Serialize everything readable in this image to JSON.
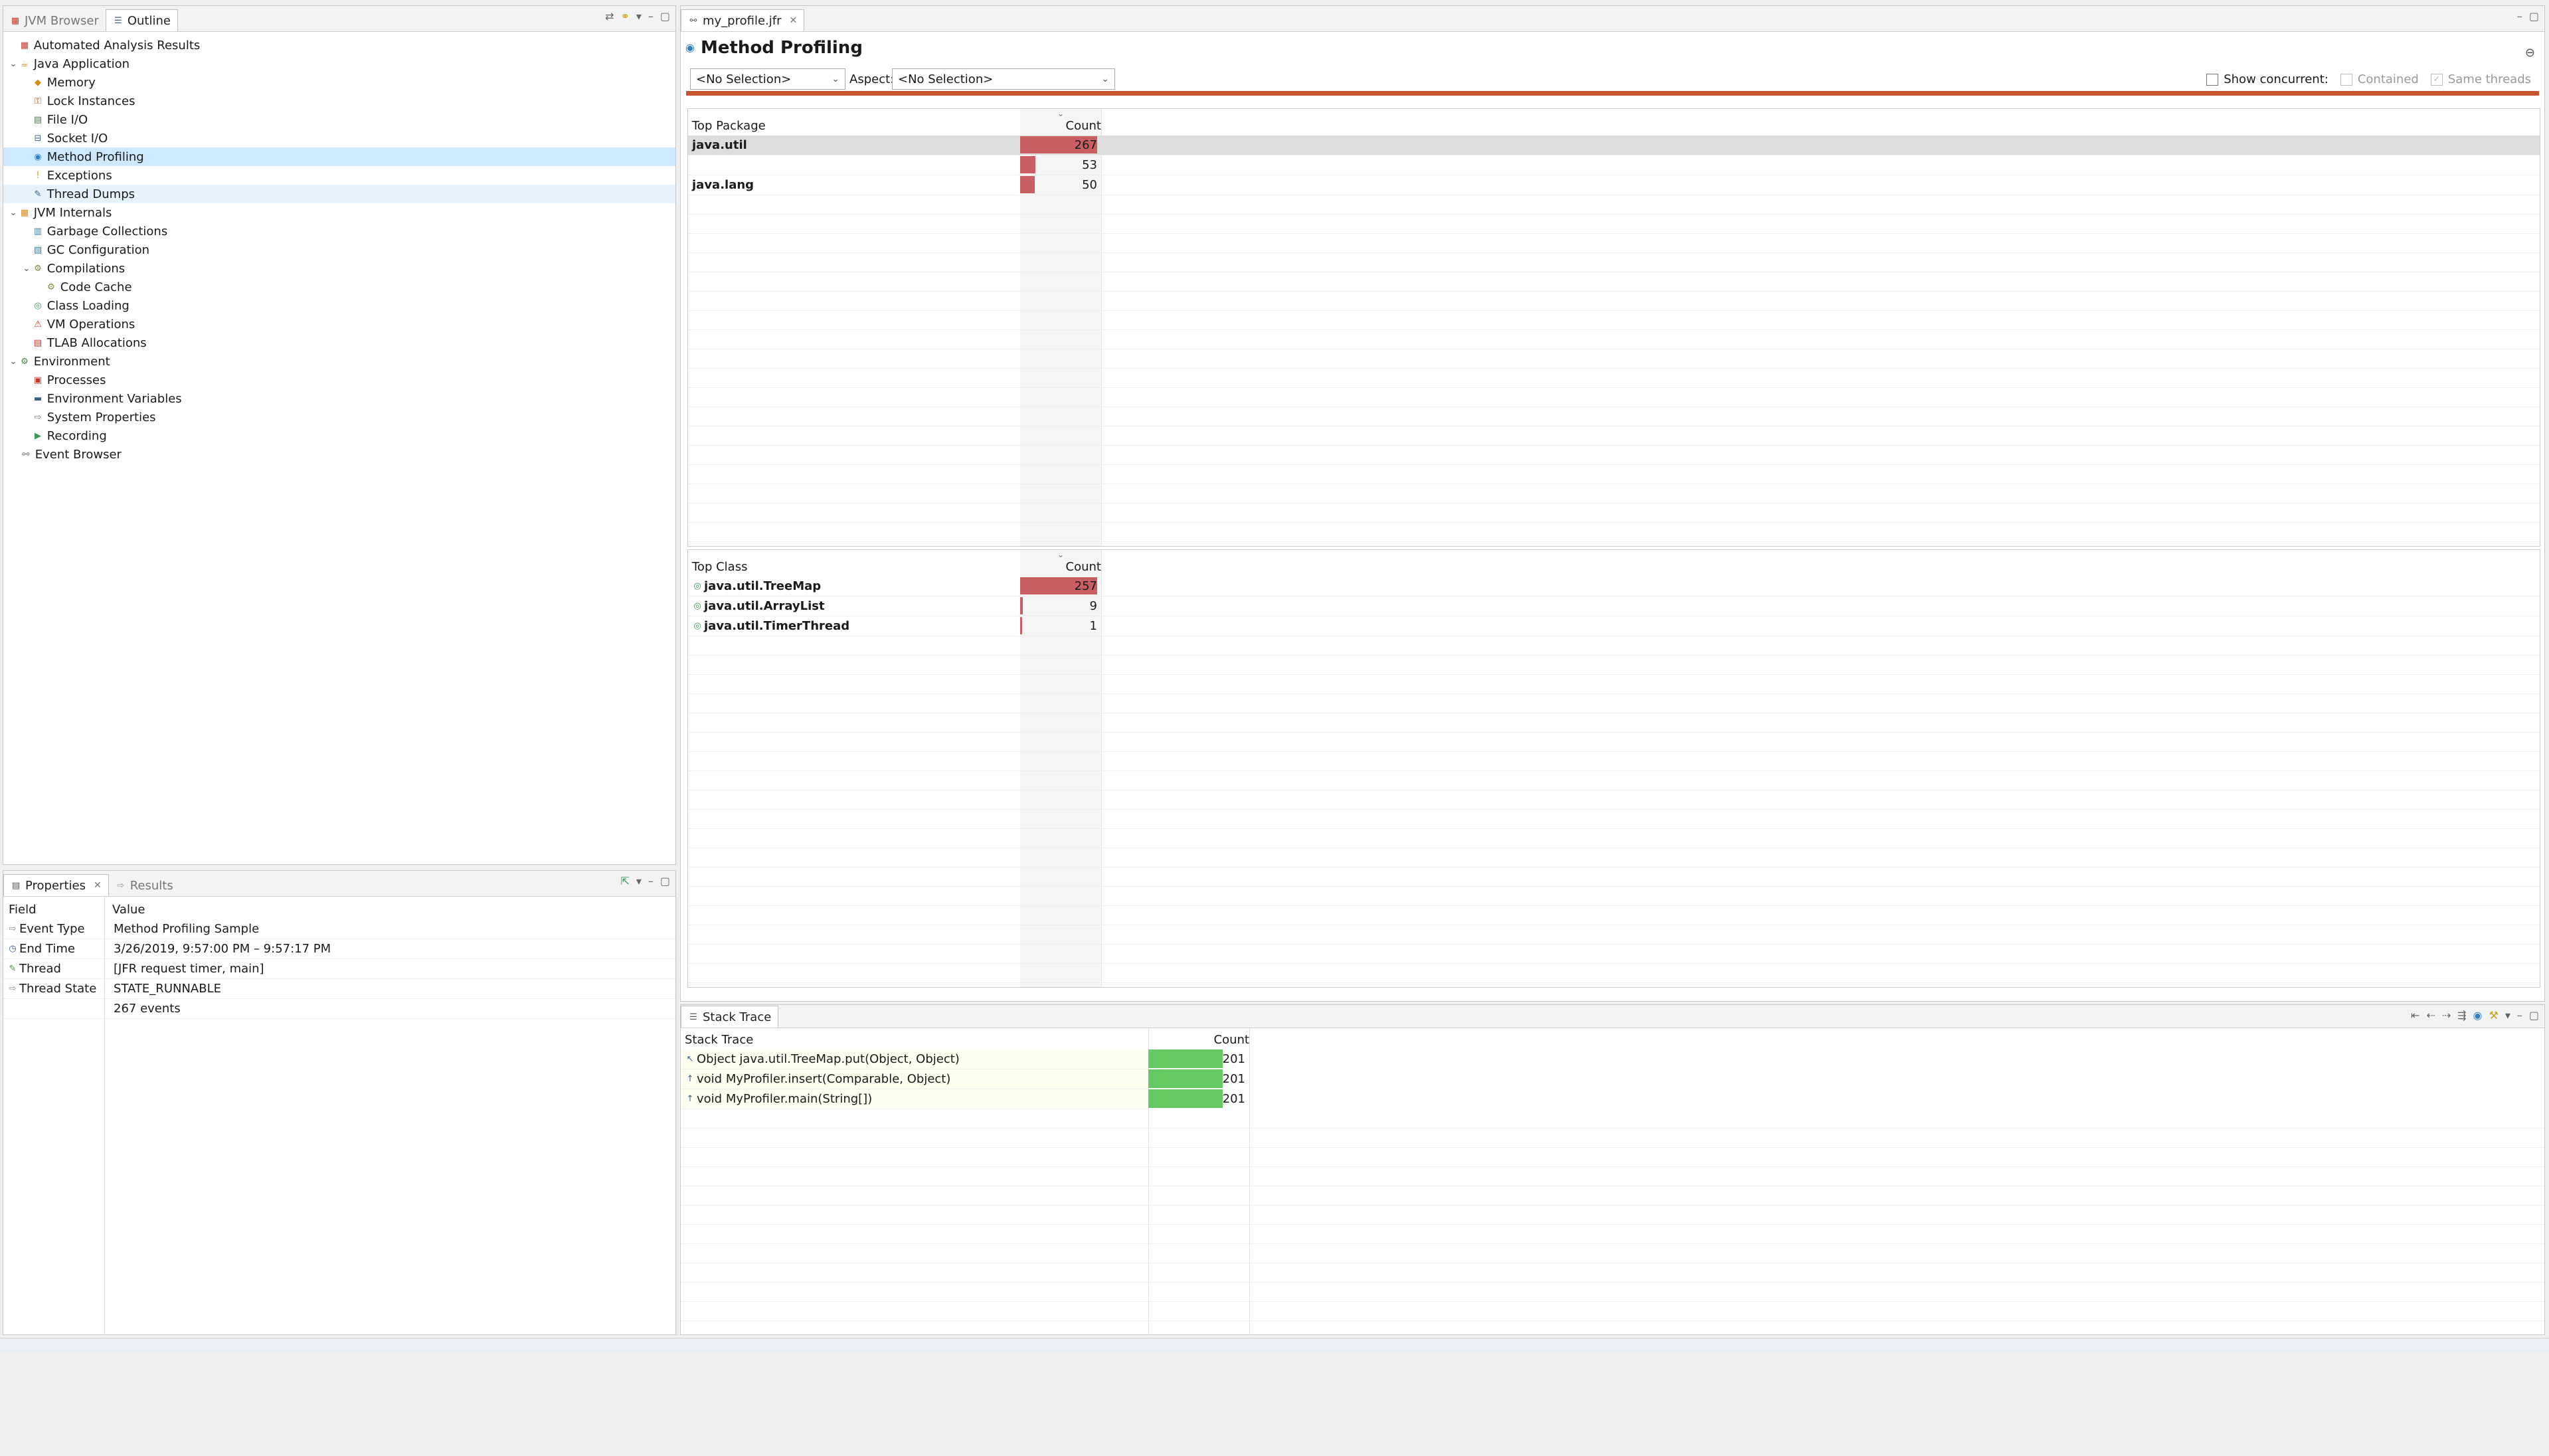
{
  "colors": {
    "accent_bar": "#c5542f",
    "count_bar": "#c95f63",
    "stack_bar": "#64c864",
    "selection": "#cde8ff"
  },
  "left_tabs": {
    "jvm_browser": "JVM Browser",
    "outline": "Outline"
  },
  "outline": {
    "items": [
      {
        "label": "Automated Analysis Results",
        "icon": "analysis-icon",
        "color": "#c0392b"
      },
      {
        "label": "Java Application",
        "icon": "java-app-icon",
        "color": "#d98a1c"
      },
      {
        "label": "Memory",
        "icon": "memory-icon",
        "color": "#d98a1c"
      },
      {
        "label": "Lock Instances",
        "icon": "lock-icon",
        "color": "#b05b2a"
      },
      {
        "label": "File I/O",
        "icon": "file-io-icon",
        "color": "#4a7a4a"
      },
      {
        "label": "Socket I/O",
        "icon": "socket-io-icon",
        "color": "#3a5f8a"
      },
      {
        "label": "Method Profiling",
        "icon": "method-profiling-icon",
        "color": "#2f7fbf"
      },
      {
        "label": "Exceptions",
        "icon": "exceptions-icon",
        "color": "#c9a227"
      },
      {
        "label": "Thread Dumps",
        "icon": "thread-dumps-icon",
        "color": "#3a5f8a"
      },
      {
        "label": "JVM Internals",
        "icon": "jvm-internals-icon",
        "color": "#d98a1c"
      },
      {
        "label": "Garbage Collections",
        "icon": "gc-icon",
        "color": "#3a7fa0"
      },
      {
        "label": "GC Configuration",
        "icon": "gc-config-icon",
        "color": "#3a7fa0"
      },
      {
        "label": "Compilations",
        "icon": "compilations-icon",
        "color": "#7a8a3a"
      },
      {
        "label": "Code Cache",
        "icon": "code-cache-icon",
        "color": "#7a8a3a"
      },
      {
        "label": "Class Loading",
        "icon": "class-loading-icon",
        "color": "#3a9a5a"
      },
      {
        "label": "VM Operations",
        "icon": "vm-operations-icon",
        "color": "#c0392b"
      },
      {
        "label": "TLAB Allocations",
        "icon": "tlab-icon",
        "color": "#c0392b"
      },
      {
        "label": "Environment",
        "icon": "environment-icon",
        "color": "#4a8a4a"
      },
      {
        "label": "Processes",
        "icon": "processes-icon",
        "color": "#c0392b"
      },
      {
        "label": "Environment Variables",
        "icon": "env-vars-icon",
        "color": "#3a5f8a"
      },
      {
        "label": "System Properties",
        "icon": "system-properties-icon",
        "color": "#777777"
      },
      {
        "label": "Recording",
        "icon": "recording-icon",
        "color": "#3a9a5a"
      },
      {
        "label": "Event Browser",
        "icon": "event-browser-icon",
        "color": "#777777"
      }
    ]
  },
  "properties_tabs": {
    "properties": "Properties",
    "results": "Results"
  },
  "properties": {
    "col_field": "Field",
    "col_value": "Value",
    "rows": [
      {
        "field": "Event Type",
        "value": "Method Profiling Sample"
      },
      {
        "field": "End Time",
        "value": "3/26/2019, 9:57:00 PM – 9:57:17 PM"
      },
      {
        "field": "Thread",
        "value": "[JFR request timer, main]"
      },
      {
        "field": "Thread State",
        "value": "STATE_RUNNABLE"
      },
      {
        "field": "",
        "value": "267 events"
      }
    ]
  },
  "editor_tab": {
    "label": "my_profile.jfr"
  },
  "page": {
    "title": "Method Profiling",
    "selection_value": "<No Selection>",
    "aspect_label": "Aspect:",
    "aspect_value": "<No Selection>",
    "show_concurrent": "Show concurrent:",
    "contained": "Contained",
    "same_threads": "Same threads"
  },
  "top_package": {
    "col_name": "Top Package",
    "col_count": "Count",
    "max": 267,
    "rows": [
      {
        "name": "java.util",
        "count": 267
      },
      {
        "name": "",
        "count": 53
      },
      {
        "name": "java.lang",
        "count": 50
      }
    ]
  },
  "top_class": {
    "col_name": "Top Class",
    "col_count": "Count",
    "max": 257,
    "rows": [
      {
        "name": "java.util.TreeMap",
        "count": 257
      },
      {
        "name": "java.util.ArrayList",
        "count": 9
      },
      {
        "name": "java.util.TimerThread",
        "count": 1
      }
    ]
  },
  "stack_trace_view": {
    "tab_label": "Stack Trace",
    "col_name": "Stack Trace",
    "col_count": "Count",
    "max": 201,
    "rows": [
      {
        "frame": "Object java.util.TreeMap.put(Object, Object)",
        "count": 201
      },
      {
        "frame": "void MyProfiler.insert(Comparable, Object)",
        "count": 201
      },
      {
        "frame": "void MyProfiler.main(String[])",
        "count": 201
      }
    ]
  }
}
